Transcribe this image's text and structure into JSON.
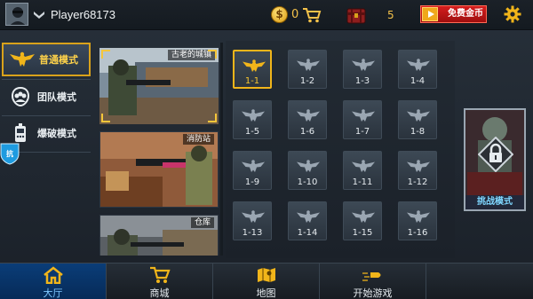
{
  "header": {
    "player_name": "Player68173",
    "coins": "0",
    "chests": "5",
    "free_gold_label": "免费金币"
  },
  "modes": [
    {
      "label": "普通模式",
      "icon": "eagle-icon",
      "active": true
    },
    {
      "label": "团队模式",
      "icon": "team-icon",
      "active": false
    },
    {
      "label": "爆破模式",
      "icon": "bomb-icon",
      "active": false
    }
  ],
  "defense_badge": "抗",
  "maps": [
    {
      "name": "古老的城镇",
      "selected": true
    },
    {
      "name": "消防站",
      "selected": false
    },
    {
      "name": "仓库",
      "selected": false
    }
  ],
  "levels": [
    "1-1",
    "1-2",
    "1-3",
    "1-4",
    "1-5",
    "1-6",
    "1-7",
    "1-8",
    "1-9",
    "1-10",
    "1-11",
    "1-12",
    "1-13",
    "1-14",
    "1-15",
    "1-16"
  ],
  "current_level": "1-1",
  "challenge_label": "挑战模式",
  "nav": [
    {
      "label": "大厅",
      "icon": "home-icon",
      "active": true
    },
    {
      "label": "商城",
      "icon": "cart-icon",
      "active": false
    },
    {
      "label": "地图",
      "icon": "map-icon",
      "active": false
    },
    {
      "label": "开始游戏",
      "icon": "bullet-icon",
      "active": false
    }
  ],
  "colors": {
    "accent": "#f1b51a",
    "nav_active": "#0a3d78",
    "challenge_text": "#7fd6ff",
    "free_gold": "#d41e1e"
  }
}
